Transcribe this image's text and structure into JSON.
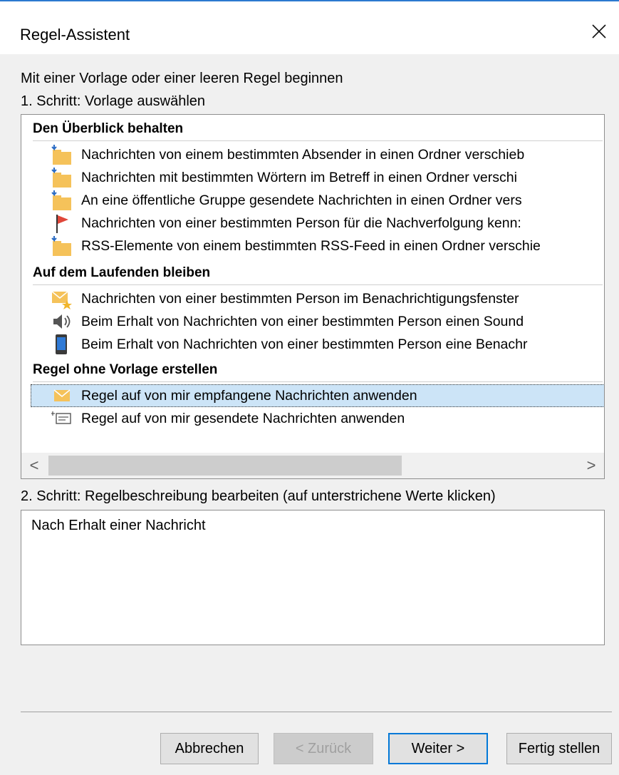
{
  "window": {
    "title": "Regel-Assistent"
  },
  "intro": {
    "heading": "Mit einer Vorlage oder einer leeren Regel beginnen",
    "step1_label": "1. Schritt: Vorlage auswählen"
  },
  "templates": {
    "sections": [
      {
        "title": "Den Überblick behalten",
        "items": [
          {
            "icon": "folder-move-icon",
            "label": "Nachrichten von einem bestimmten Absender in einen Ordner verschieb"
          },
          {
            "icon": "folder-move-icon",
            "label": "Nachrichten mit bestimmten Wörtern im Betreff in einen Ordner verschi"
          },
          {
            "icon": "folder-move-icon",
            "label": "An eine öffentliche Gruppe gesendete Nachrichten in einen Ordner vers"
          },
          {
            "icon": "flag-icon",
            "label": "Nachrichten von einer bestimmten Person für die Nachverfolgung kenn:"
          },
          {
            "icon": "folder-move-icon",
            "label": "RSS-Elemente von einem bestimmten RSS-Feed in einen Ordner verschie"
          }
        ]
      },
      {
        "title": "Auf dem Laufenden bleiben",
        "items": [
          {
            "icon": "mail-alert-icon",
            "label": "Nachrichten von einer bestimmten Person im Benachrichtigungsfenster"
          },
          {
            "icon": "speaker-icon",
            "label": "Beim Erhalt von Nachrichten von einer bestimmten Person einen Sound"
          },
          {
            "icon": "mobile-device-icon",
            "label": "Beim Erhalt von Nachrichten von einer bestimmten Person eine Benachr"
          }
        ]
      },
      {
        "title": "Regel ohne Vorlage erstellen",
        "items": [
          {
            "icon": "envelope-icon",
            "label": "Regel auf von mir empfangene Nachrichten anwenden",
            "selected": true
          },
          {
            "icon": "sent-mail-icon",
            "label": "Regel auf von mir gesendete Nachrichten anwenden"
          }
        ]
      }
    ],
    "scroll_left": "<",
    "scroll_right": ">"
  },
  "step2": {
    "label": "2. Schritt: Regelbeschreibung bearbeiten (auf unterstrichene Werte klicken)",
    "description": "Nach Erhalt einer Nachricht"
  },
  "buttons": {
    "cancel": "Abbrechen",
    "back": "< Zurück",
    "next": "Weiter >",
    "finish": "Fertig stellen"
  },
  "colors": {
    "accent": "#0078d7",
    "selection": "#cce4f7",
    "folder": "#f5c25a",
    "flag": "#e0473a"
  }
}
